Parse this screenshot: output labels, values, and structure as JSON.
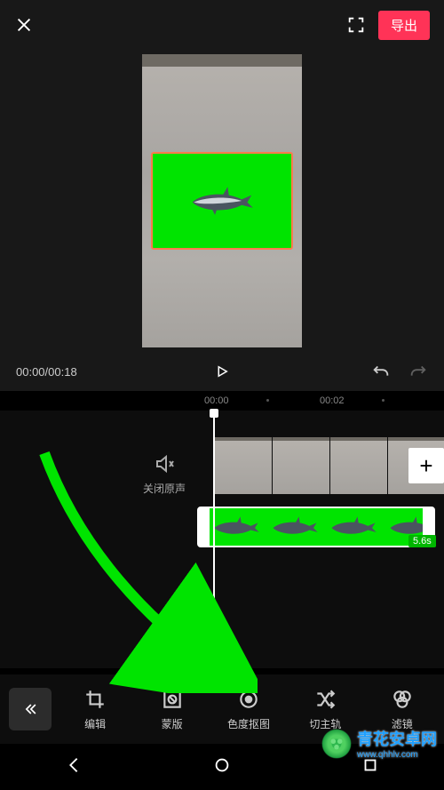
{
  "topbar": {
    "export_label": "导出"
  },
  "playback": {
    "time_text": "00:00/00:18"
  },
  "timeline_ticks": {
    "t0": "00:00",
    "t1": "00:02"
  },
  "audio": {
    "mute_label": "关闭原声"
  },
  "overlay_clip": {
    "duration_label": "5.6s"
  },
  "tools": {
    "edit": "编辑",
    "mask": "蒙版",
    "chroma": "色度抠图",
    "swap_track": "切主轨",
    "filter": "滤镜"
  },
  "watermark": {
    "title": "青花安卓网",
    "url": "www.qhhlv.com"
  }
}
